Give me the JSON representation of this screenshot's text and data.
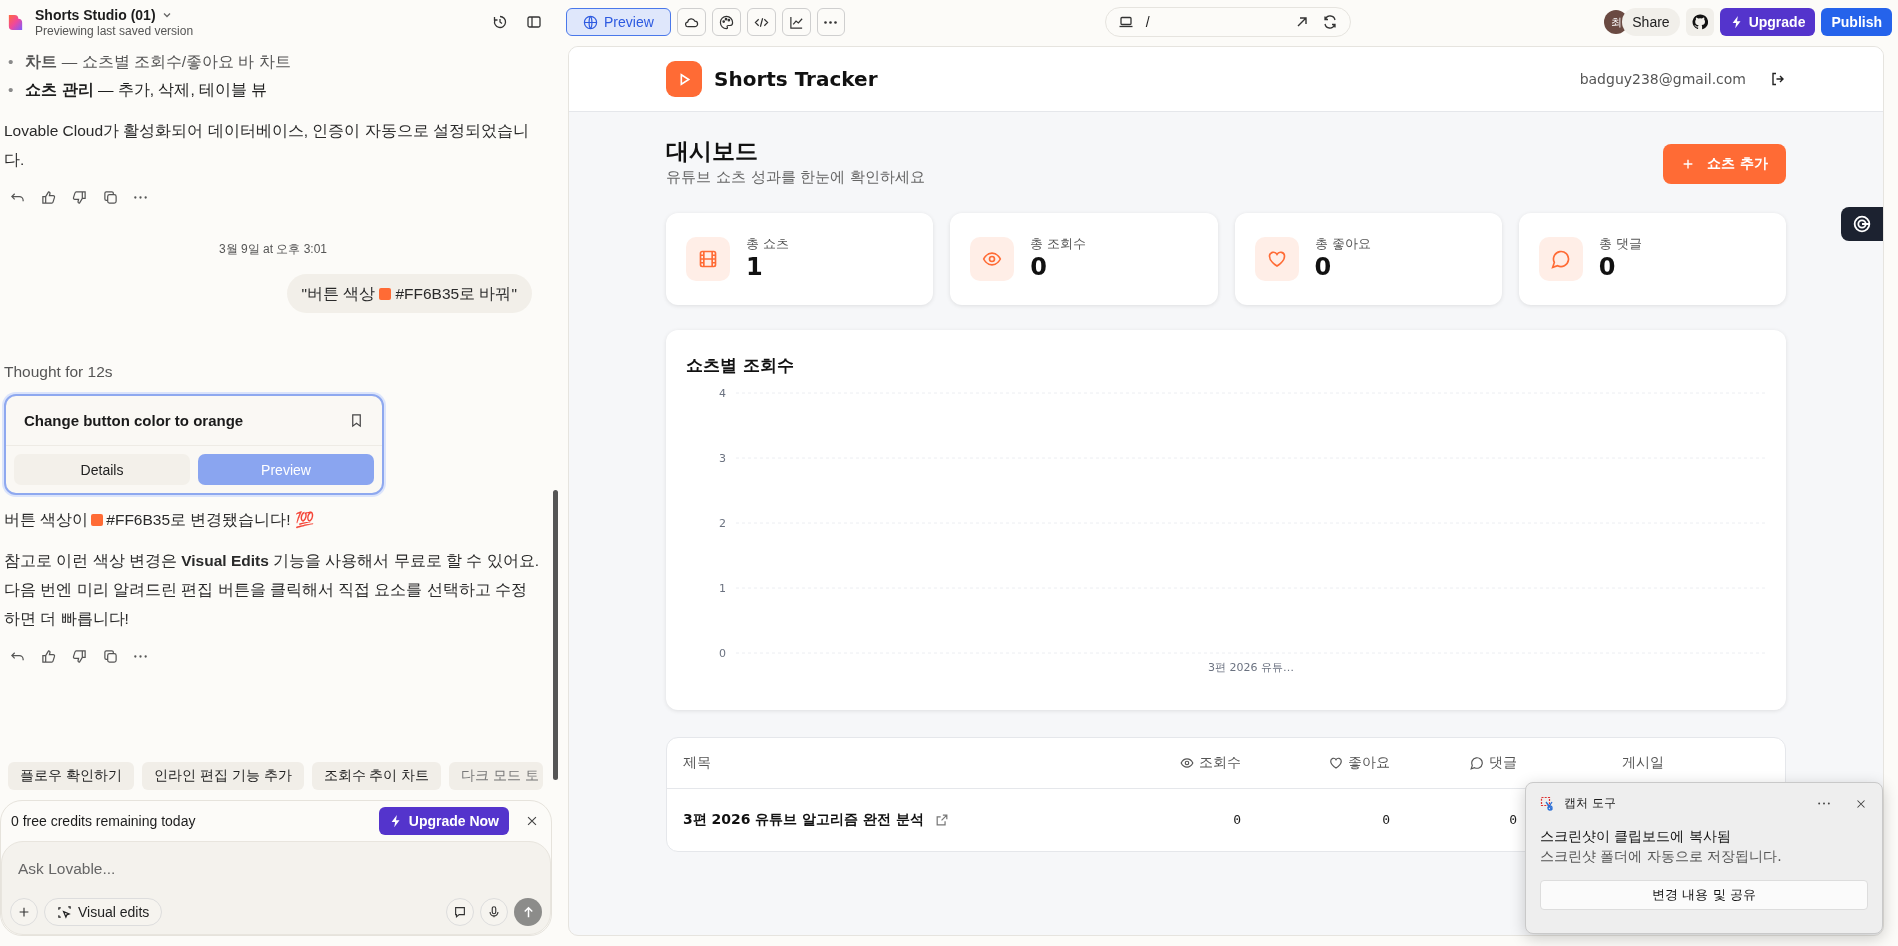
{
  "app": {
    "project_name": "Shorts Studio (01)",
    "subtitle": "Previewing last saved version"
  },
  "toolbar": {
    "tabs": [
      {
        "kind": "preview",
        "label": "Preview",
        "selected": true
      },
      {
        "kind": "cloud",
        "selected": false
      },
      {
        "kind": "palette",
        "selected": false
      },
      {
        "kind": "code",
        "selected": false
      },
      {
        "kind": "chart",
        "selected": false
      },
      {
        "kind": "more",
        "selected": false
      }
    ]
  },
  "address_bar": {
    "path": "/"
  },
  "header_actions": {
    "avatar_text": "최",
    "share": "Share",
    "upgrade": "Upgrade",
    "publish": "Publish"
  },
  "chat": {
    "items": [
      {
        "kind": "bullets",
        "marker": "•",
        "items": [
          "**차트** — 쇼츠별 조회수/좋아요 바 차트",
          "**쇼츠 관리** — 추가, 삭제, 테이블 뷰"
        ]
      },
      {
        "kind": "paragraph",
        "text": "Lovable Cloud가 활성화되어 데이터베이스, 인증이 자동으로 설정되었습니다."
      },
      {
        "kind": "actions"
      },
      {
        "kind": "timestamp",
        "text": "3월 9일 at 오후 3:01"
      },
      {
        "kind": "user",
        "before": "\"버튼 색상",
        "color": "#ff6b35",
        "after": "#FF6B35로 바꿔\""
      },
      {
        "kind": "thought",
        "text": "Thought for 12s"
      },
      {
        "kind": "card",
        "title": "Change button color to orange",
        "details": "Details",
        "preview": "Preview"
      },
      {
        "kind": "swatch_line",
        "before": "버튼 색상이",
        "color": "#ff6b35",
        "after": "#FF6B35로 변경됐습니다! 💯"
      },
      {
        "kind": "paragraph",
        "text": "참고로 이런 색상 변경은 **Visual Edits** 기능을 사용해서 무료로 할 수 있어요. 다음 번엔 미리 알려드린 편집 버튼을 클릭해서 직접 요소를 선택하고 수정하면 더 빠릅니다!"
      },
      {
        "kind": "actions"
      }
    ]
  },
  "suggestions": [
    "플로우 확인하기",
    "인라인 편집 기능 추가",
    "조회수 추이 차트",
    "다크 모드 토"
  ],
  "credits": {
    "text": "0 free credits remaining today",
    "button": "Upgrade Now"
  },
  "composer": {
    "placeholder": "Ask Lovable...",
    "visual_edits": "Visual edits"
  },
  "preview": {
    "brand": "Shorts Tracker",
    "email": "badguy238@gmail.com",
    "title": "대시보드",
    "subtitle": "유튜브 쇼츠 성과를 한눈에 확인하세요",
    "add_button": "쇼츠 추가",
    "stats": [
      {
        "kind": "film",
        "label": "총 쇼츠",
        "value": "1"
      },
      {
        "kind": "eye",
        "label": "총 조회수",
        "value": "0"
      },
      {
        "kind": "heart",
        "label": "총 좋아요",
        "value": "0"
      },
      {
        "kind": "comment",
        "label": "총 댓글",
        "value": "0"
      }
    ],
    "chart_title": "쇼츠별 조회수",
    "chart_data": {
      "type": "bar",
      "categories": [
        "3편 2026 유튜…"
      ],
      "values": [
        0
      ],
      "ylim": [
        0,
        4
      ],
      "yticks": [
        0,
        1,
        2,
        3,
        4
      ],
      "grid": true
    },
    "table": {
      "columns": [
        {
          "kind": "text",
          "label": "제목"
        },
        {
          "kind": "eye",
          "label": "조회수"
        },
        {
          "kind": "heart",
          "label": "좋아요"
        },
        {
          "kind": "comment",
          "label": "댓글"
        },
        {
          "kind": "text",
          "label": "게시일"
        }
      ],
      "rows": [
        {
          "cells": [
            "3편 2026 유튜브 알고리즘 완전 분석",
            "0",
            "0",
            "0"
          ]
        }
      ]
    }
  },
  "toast": {
    "app": "캡처 도구",
    "heading": "스크린샷이 클립보드에 복사됨",
    "body": "스크린샷 폴더에 자동으로 저장됩니다.",
    "button": "변경 내용 및 공유"
  }
}
